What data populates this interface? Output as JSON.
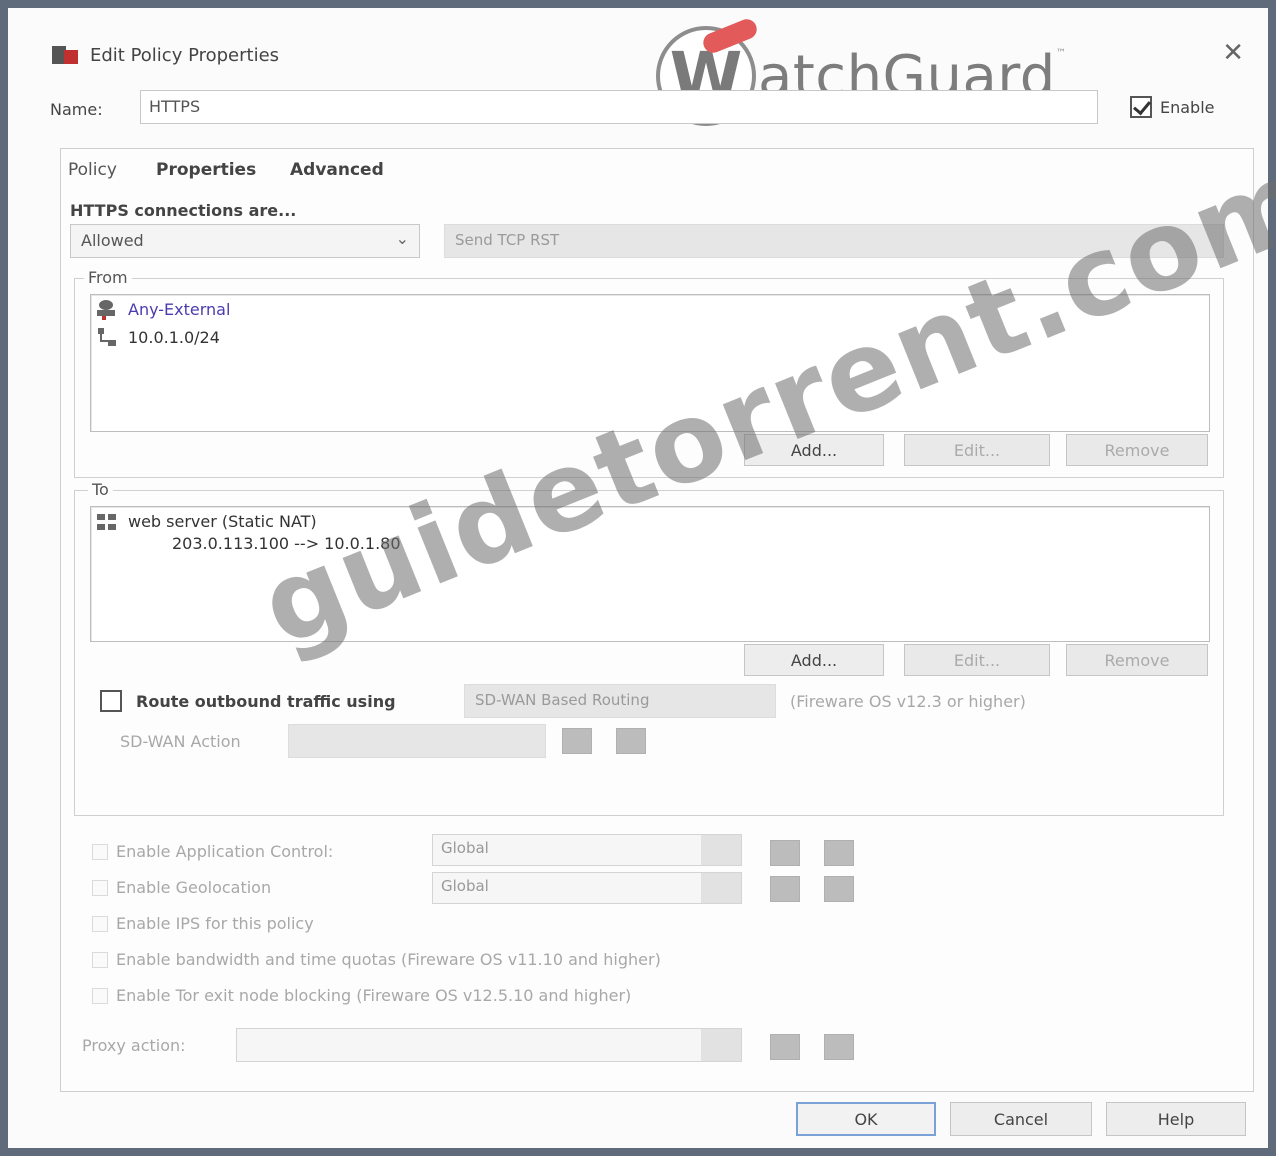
{
  "window": {
    "title": "Edit Policy Properties",
    "close_glyph": "✕"
  },
  "logo": {
    "text": "atchGuard",
    "letter": "W",
    "tm": "™"
  },
  "name_row": {
    "label": "Name:",
    "value": "HTTPS",
    "enable_label": "Enable",
    "enable_checked": true
  },
  "tabs": [
    {
      "label": "Policy",
      "active": true
    },
    {
      "label": "Properties",
      "active": false
    },
    {
      "label": "Advanced",
      "active": false
    }
  ],
  "connections": {
    "label": "HTTPS connections are...",
    "selected": "Allowed",
    "disabled_option": "Send TCP RST"
  },
  "from": {
    "legend": "From",
    "items": [
      {
        "icon": "alias-icon",
        "text": "Any-External"
      },
      {
        "icon": "network-icon",
        "text": "10.0.1.0/24"
      }
    ],
    "buttons": {
      "add": "Add...",
      "edit": "Edit...",
      "remove": "Remove"
    }
  },
  "to": {
    "legend": "To",
    "items": [
      {
        "icon": "server-icon",
        "text": "web server (Static NAT)",
        "sub": "203.0.113.100 --> 10.0.1.80"
      }
    ],
    "buttons": {
      "add": "Add...",
      "edit": "Edit...",
      "remove": "Remove"
    }
  },
  "route": {
    "label": "Route outbound traffic using",
    "dropdown": "SD-WAN Based Routing",
    "note": "(Fireware OS v12.3 or higher)",
    "sdwan_label": "SD-WAN Action"
  },
  "options": [
    {
      "label": "Enable Application Control:",
      "select": "Global"
    },
    {
      "label": "Enable Geolocation",
      "select": "Global"
    },
    {
      "label": "Enable IPS for this policy",
      "select": ""
    },
    {
      "label": "Enable bandwidth and time quotas (Fireware OS v11.10 and higher)",
      "select": ""
    },
    {
      "label": "Enable Tor exit node blocking (Fireware OS v12.5.10 and higher)",
      "select": ""
    }
  ],
  "proxy": {
    "label": "Proxy action:"
  },
  "footer": {
    "ok": "OK",
    "cancel": "Cancel",
    "help": "Help"
  },
  "watermark": "guidetorrent.com"
}
